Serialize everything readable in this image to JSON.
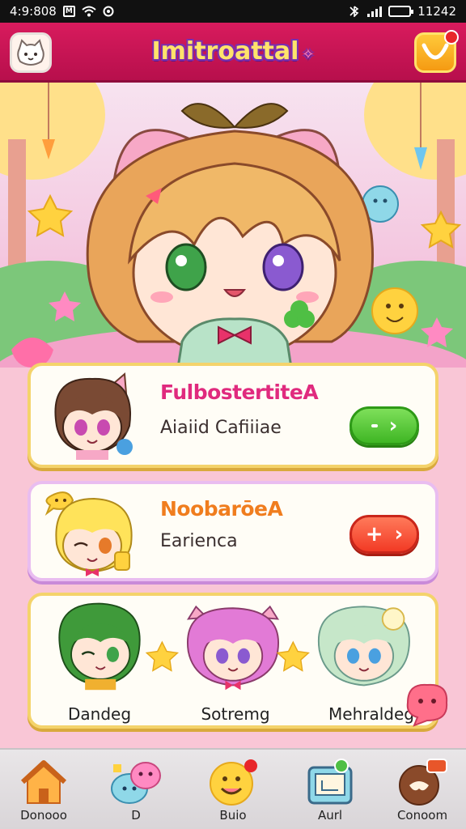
{
  "status_bar": {
    "time": "4:9:808",
    "left_box": "M",
    "right_text": "11242"
  },
  "header": {
    "title": "Imitroattal",
    "title_deco": "✧"
  },
  "cards": [
    {
      "title": "FulbostertiteA",
      "subtitle": "Aiaiid Cafiiiae",
      "button": "›",
      "button_color": "#3fb624"
    },
    {
      "title": "NoobarōeA",
      "subtitle": "Earienca",
      "button_plus": "+",
      "button": "›",
      "button_color": "#f23a25"
    }
  ],
  "characters": [
    {
      "name": "Dandeg",
      "hair": "#3f9a3a"
    },
    {
      "name": "Sotremg",
      "hair": "#e27ad6"
    },
    {
      "name": "Mehraldeg",
      "hair": "#c6e7c9"
    }
  ],
  "nav": [
    {
      "label": "Donooo",
      "icon": "house-icon"
    },
    {
      "label": "D",
      "icon": "blob-friends-icon"
    },
    {
      "label": "Buio",
      "icon": "smiley-icon"
    },
    {
      "label": "Aurl",
      "icon": "frame-icon"
    },
    {
      "label": "Conoom",
      "icon": "cookie-icon"
    }
  ],
  "colors": {
    "header": "#d81b5d",
    "title_fill": "#ffe36b",
    "title_stroke": "#7a2fb0",
    "card1_title": "#e02a7e",
    "card2_title": "#f07d1e"
  }
}
